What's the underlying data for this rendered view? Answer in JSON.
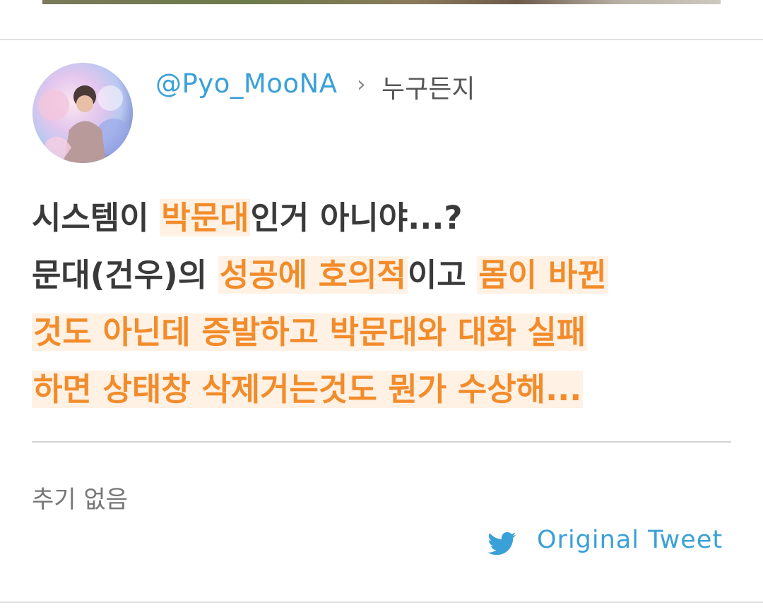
{
  "tweet": {
    "handle": "@Pyo_MooNA",
    "list_name": "누구든지",
    "lines": [
      [
        {
          "text": "시스템이 ",
          "hl": false
        },
        {
          "text": "박문대",
          "hl": true
        },
        {
          "text": "인거 아니야...?",
          "hl": false
        }
      ],
      [
        {
          "text": "문대(건우)의 ",
          "hl": false
        },
        {
          "text": "성공에 호의적",
          "hl": true
        },
        {
          "text": "이고 ",
          "hl": false
        },
        {
          "text": "몸이 바뀐",
          "hl": true
        }
      ],
      [
        {
          "text": "것도 아닌데 증발하고 박문대와 대화 실패",
          "hl": true
        }
      ],
      [
        {
          "text": "하면 상태창 삭제거는것도 뭔가 수상해...",
          "hl": true
        }
      ]
    ],
    "highlight_color": "#f28c2b",
    "highlight_bg": "#fff1e4"
  },
  "footer": {
    "notes_text": "추기 없음",
    "original_label": "Original Tweet",
    "original_icon": "twitter-bird-icon",
    "link_color": "#3aa0d8"
  }
}
